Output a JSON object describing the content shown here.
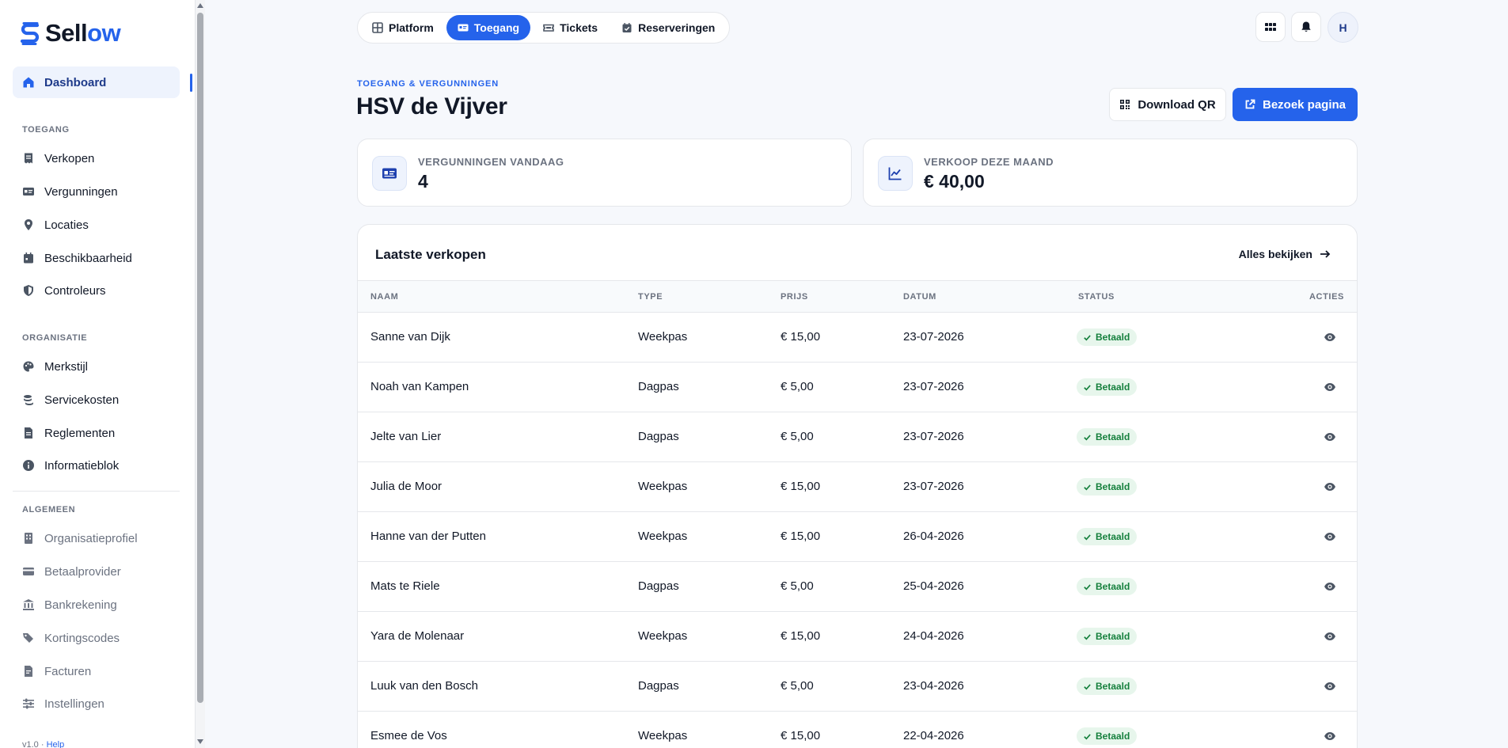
{
  "app": {
    "logo_text": "Sell",
    "logo_accent": "ow"
  },
  "colors": {
    "accent": "#2563eb",
    "success": "#15803d",
    "success_bg": "#e7f6ec"
  },
  "sidebar": {
    "dashboard": {
      "label": "Dashboard",
      "icon": "home-icon"
    },
    "sections": {
      "toegang": "TOEGANG",
      "organisatie": "ORGANISATIE",
      "algemeen": "ALGEMEEN"
    },
    "toegang_items": [
      {
        "label": "Verkopen",
        "icon": "receipt-icon"
      },
      {
        "label": "Vergunningen",
        "icon": "id-card-icon"
      },
      {
        "label": "Locaties",
        "icon": "map-pin-icon"
      },
      {
        "label": "Beschikbaarheid",
        "icon": "calendar-icon"
      },
      {
        "label": "Controleurs",
        "icon": "shield-icon"
      }
    ],
    "organisatie_items": [
      {
        "label": "Merkstijl",
        "icon": "palette-icon"
      },
      {
        "label": "Servicekosten",
        "icon": "coins-icon"
      },
      {
        "label": "Reglementen",
        "icon": "document-icon"
      },
      {
        "label": "Informatieblok",
        "icon": "info-icon"
      }
    ],
    "algemeen_items": [
      {
        "label": "Organisatieprofiel",
        "icon": "building-icon"
      },
      {
        "label": "Betaalprovider",
        "icon": "credit-card-icon"
      },
      {
        "label": "Bankrekening",
        "icon": "bank-icon"
      },
      {
        "label": "Kortingscodes",
        "icon": "tags-icon"
      },
      {
        "label": "Facturen",
        "icon": "invoice-icon"
      },
      {
        "label": "Instellingen",
        "icon": "sliders-icon"
      }
    ],
    "version": "v1.0 · ",
    "help": "Help"
  },
  "topnav": {
    "tabs": [
      {
        "label": "Platform",
        "icon": "grid-icon"
      },
      {
        "label": "Toegang",
        "icon": "ticket-card-icon",
        "active": true
      },
      {
        "label": "Tickets",
        "icon": "ticket-icon"
      },
      {
        "label": "Reserveringen",
        "icon": "calendar-check-icon"
      }
    ],
    "avatar_initial": "H"
  },
  "header": {
    "eyebrow": "TOEGANG & VERGUNNINGEN",
    "title": "HSV de Vijver",
    "download_qr": "Download QR",
    "visit_page": "Bezoek pagina"
  },
  "stats": [
    {
      "label": "VERGUNNINGEN VANDAAG",
      "value": "4",
      "icon": "id-card-icon"
    },
    {
      "label": "VERKOOP DEZE MAAND",
      "value": "€ 40,00",
      "icon": "trend-chart-icon"
    }
  ],
  "sales": {
    "title": "Laatste verkopen",
    "see_all": "Alles bekijken",
    "columns": [
      "NAAM",
      "TYPE",
      "PRIJS",
      "DATUM",
      "STATUS",
      "ACTIES"
    ],
    "rows": [
      {
        "name": "Sanne van Dijk",
        "type": "Weekpas",
        "price": "€ 15,00",
        "date": "23-07-2026",
        "status": "Betaald"
      },
      {
        "name": "Noah van Kampen",
        "type": "Dagpas",
        "price": "€ 5,00",
        "date": "23-07-2026",
        "status": "Betaald"
      },
      {
        "name": "Jelte van Lier",
        "type": "Dagpas",
        "price": "€ 5,00",
        "date": "23-07-2026",
        "status": "Betaald"
      },
      {
        "name": "Julia de Moor",
        "type": "Weekpas",
        "price": "€ 15,00",
        "date": "23-07-2026",
        "status": "Betaald"
      },
      {
        "name": "Hanne van der Putten",
        "type": "Weekpas",
        "price": "€ 15,00",
        "date": "26-04-2026",
        "status": "Betaald"
      },
      {
        "name": "Mats te Riele",
        "type": "Dagpas",
        "price": "€ 5,00",
        "date": "25-04-2026",
        "status": "Betaald"
      },
      {
        "name": "Yara de Molenaar",
        "type": "Weekpas",
        "price": "€ 15,00",
        "date": "24-04-2026",
        "status": "Betaald"
      },
      {
        "name": "Luuk van den Bosch",
        "type": "Dagpas",
        "price": "€ 5,00",
        "date": "23-04-2026",
        "status": "Betaald"
      },
      {
        "name": "Esmee de Vos",
        "type": "Weekpas",
        "price": "€ 15,00",
        "date": "22-04-2026",
        "status": "Betaald"
      }
    ]
  }
}
